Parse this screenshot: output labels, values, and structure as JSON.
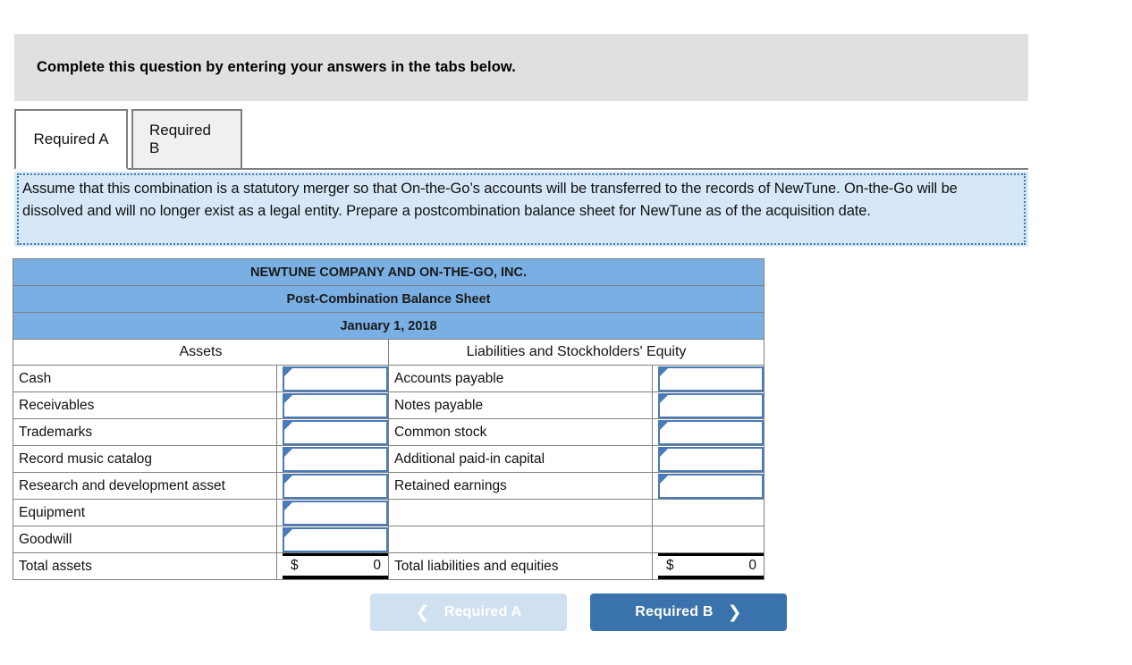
{
  "banner": {
    "text": "Complete this question by entering your answers in the tabs below."
  },
  "tabs": [
    {
      "label": "Required A",
      "active": true
    },
    {
      "label": "Required B",
      "active": false
    }
  ],
  "prompt": {
    "text": "Assume that this combination is a statutory merger so that On-the-Go’s accounts will be transferred to the records of NewTune. On-the-Go will be dissolved and will no longer exist as a legal entity. Prepare a postcombination balance sheet for NewTune as of the acquisition date."
  },
  "sheet": {
    "title_line_1": "NEWTUNE COMPANY AND ON-THE-GO, INC.",
    "title_line_2": "Post-Combination Balance Sheet",
    "title_line_3": "January 1, 2018",
    "section_assets": "Assets",
    "section_liabilities": "Liabilities and Stockholders' Equity",
    "rows": [
      {
        "asset": "Cash",
        "asset_value": "",
        "liability": "Accounts payable",
        "liability_value": ""
      },
      {
        "asset": "Receivables",
        "asset_value": "",
        "liability": "Notes payable",
        "liability_value": ""
      },
      {
        "asset": "Trademarks",
        "asset_value": "",
        "liability": "Common stock",
        "liability_value": ""
      },
      {
        "asset": "Record music catalog",
        "asset_value": "",
        "liability": "Additional paid-in capital",
        "liability_value": ""
      },
      {
        "asset": "Research and development asset",
        "asset_value": "",
        "liability": "Retained earnings",
        "liability_value": ""
      },
      {
        "asset": "Equipment",
        "asset_value": "",
        "liability": "",
        "liability_value": null
      },
      {
        "asset": "Goodwill",
        "asset_value": "",
        "liability": "",
        "liability_value": null
      }
    ],
    "total_assets_label": "Total assets",
    "total_assets_currency": "$",
    "total_assets_value": "0",
    "total_liabilities_label": "Total liabilities and equities",
    "total_liabilities_currency": "$",
    "total_liabilities_value": "0"
  },
  "nav": {
    "prev_label": "Required A",
    "prev_icon": "chevron-left-icon",
    "next_label": "Required B",
    "next_icon": "chevron-right-icon"
  },
  "colors": {
    "header_blue": "#7aafe3",
    "prompt_blue": "#d6e8f7",
    "banner_gray": "#e0e0e0",
    "input_border": "#4a7ab8",
    "next_button": "#3a72ab",
    "prev_button": "#cfe0f0"
  }
}
